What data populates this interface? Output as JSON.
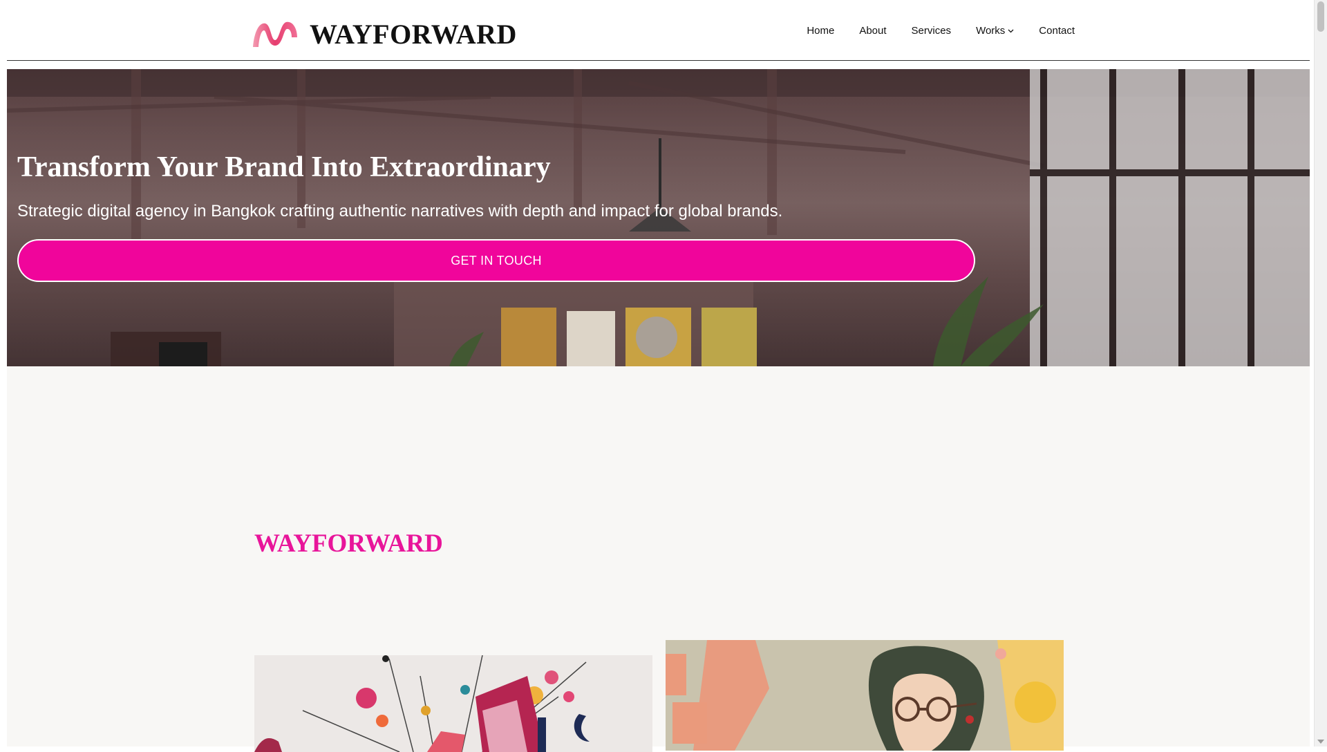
{
  "header": {
    "brand_name": "WAYFORWARD",
    "nav": [
      {
        "label": "Home"
      },
      {
        "label": "About"
      },
      {
        "label": "Services"
      },
      {
        "label": "Works",
        "has_dropdown": true
      },
      {
        "label": "Contact"
      }
    ]
  },
  "hero": {
    "title": "Transform Your Brand Into Extraordinary",
    "subtitle": "Strategic digital agency in Bangkok crafting authentic narratives with depth and impact for global brands.",
    "cta_label": "GET IN TOUCH"
  },
  "section": {
    "heading": "WAYFORWARD"
  },
  "colors": {
    "accent": "#f0059b",
    "heading_accent": "#e8159a",
    "text": "#111111",
    "background": "#f8f7f5"
  },
  "icons": [
    "wayforward-logo-mark",
    "chevron-down-icon"
  ]
}
